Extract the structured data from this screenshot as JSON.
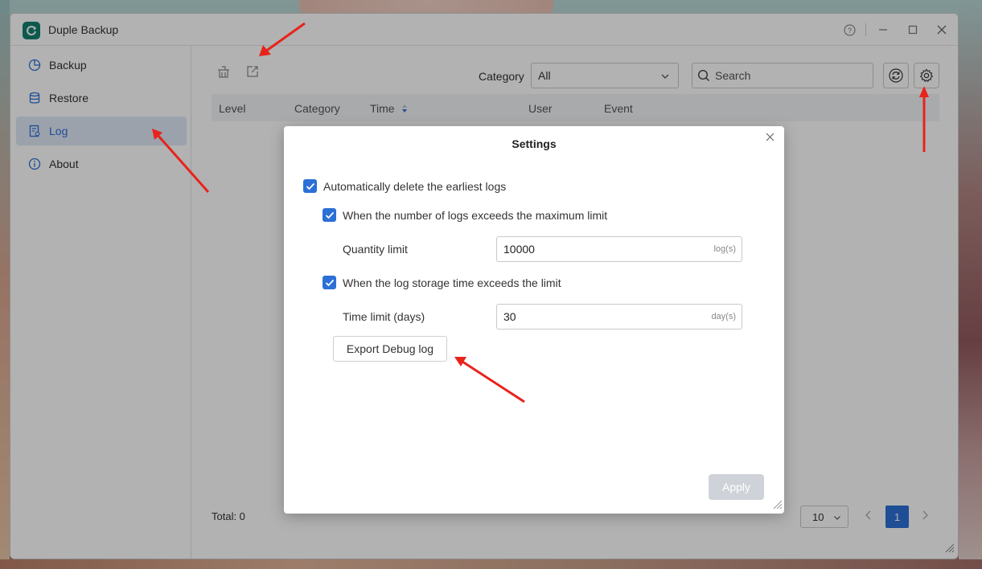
{
  "window": {
    "title": "Duple Backup"
  },
  "sidebar": {
    "items": [
      {
        "label": "Backup",
        "icon": "pie-chart-icon"
      },
      {
        "label": "Restore",
        "icon": "database-icon"
      },
      {
        "label": "Log",
        "icon": "log-file-icon",
        "active": true
      },
      {
        "label": "About",
        "icon": "info-icon"
      }
    ]
  },
  "toolbar": {
    "category_label": "Category",
    "category_value": "All",
    "search_placeholder": "Search"
  },
  "table": {
    "columns": [
      "Level",
      "Category",
      "Time",
      "User",
      "Event"
    ]
  },
  "footer": {
    "total": "Total: 0",
    "page_size": "10",
    "current_page": "1"
  },
  "dialog": {
    "title": "Settings",
    "auto_delete_label": "Automatically delete the earliest logs",
    "auto_delete_checked": true,
    "max_limit_label": "When the number of logs exceeds the maximum limit",
    "max_limit_checked": true,
    "quantity_label": "Quantity limit",
    "quantity_value": "10000",
    "quantity_unit": "log(s)",
    "time_limit_check_label": "When the log storage time exceeds the limit",
    "time_limit_checked": true,
    "time_label": "Time limit (days)",
    "time_value": "30",
    "time_unit": "day(s)",
    "export_label": "Export Debug log",
    "apply_label": "Apply"
  },
  "colors": {
    "accent": "#2b70d6",
    "active_nav_bg": "#dfe9f7",
    "annotation_arrow": "#e8231c",
    "apply_disabled": "#cfd3d9"
  }
}
